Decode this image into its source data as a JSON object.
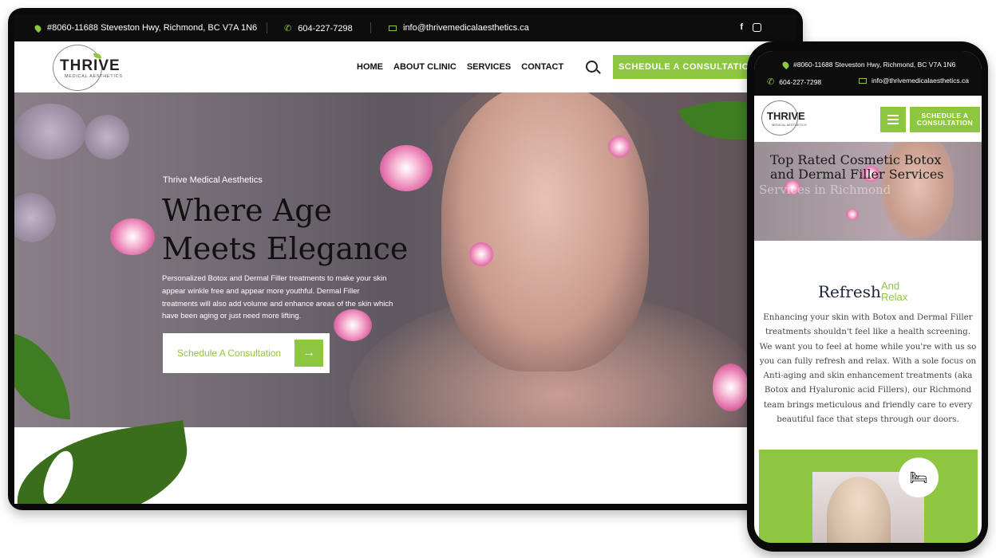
{
  "desktop": {
    "topbar": {
      "address": "#8060-11688 Steveston Hwy, Richmond, BC V7A 1N6",
      "phone": "604-227-7298",
      "email": "info@thrivemedicalaesthetics.ca",
      "social_facebook": "f",
      "social_instagram": "instagram"
    },
    "nav": {
      "logo_word": "THRIVE",
      "logo_sub": "MEDICAL AESTHETICS",
      "items": [
        "HOME",
        "ABOUT CLINIC",
        "SERVICES",
        "CONTACT"
      ],
      "cta": "SCHEDULE A CONSULTATION"
    },
    "hero": {
      "eyebrow": "Thrive Medical Aesthetics",
      "title_line1": "Where Age",
      "title_line2": "Meets Elegance",
      "paragraph": "Personalized Botox and Dermal Filler treatments to make your skin appear winkle free and appear more youthful. Dermal Filler treatments will also add volume and enhance areas of the skin which have been aging or just need more lifting.",
      "button": "Schedule A Consultation",
      "button_arrow": "→"
    }
  },
  "mobile": {
    "topbar": {
      "address": "#8060-11688 Steveston Hwy, Richmond, BC V7A 1N6",
      "phone": "604-227-7298",
      "email": "info@thrivemedicalaesthetics.ca"
    },
    "nav": {
      "logo_word": "THRIVE",
      "logo_sub": "MEDICAL AESTHETICS",
      "cta_line1": "SCHEDULE A",
      "cta_line2": "CONSULTATION"
    },
    "hero": {
      "title": "Top Rated Cosmetic Botox and Dermal Filler Services",
      "subtitle_faded": "Services in Richmond"
    },
    "section": {
      "heading": "Refresh",
      "accent_line1": "And",
      "accent_line2": "Relax",
      "body": "Enhancing your skin with Botox and Dermal Filler treatments shouldn't feel like a health screening. We want you to feel at home while you're with us so you can fully refresh and relax. With a sole focus on Anti-aging and skin enhancement treatments (aka Botox and Hyaluronic acid Fillers), our Richmond team brings meticulous and friendly care to every beautiful face that steps through our doors."
    }
  },
  "colors": {
    "accent": "#8dc63f",
    "topbar_bg": "#0d0d0d",
    "heading_dark": "#111111"
  }
}
